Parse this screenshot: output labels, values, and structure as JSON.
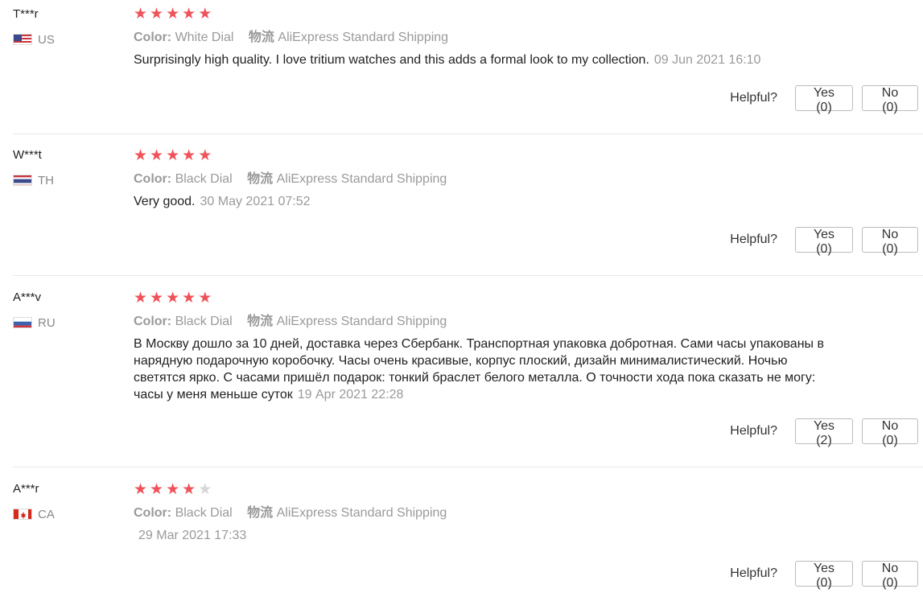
{
  "labels": {
    "color": "Color:",
    "shipping_label": "物流",
    "helpful": "Helpful?"
  },
  "colors": {
    "star_on": "#f0525a",
    "star_off": "#d6d6d6"
  },
  "reviews": [
    {
      "user": "T***r",
      "country": "US",
      "rating": 5,
      "color_value": "White Dial",
      "shipping": "AliExpress Standard Shipping",
      "text": "Surprisingly high quality. I love tritium watches and this adds a formal look to my collection.",
      "date": "09 Jun 2021 16:10",
      "yes": "Yes (0)",
      "no": "No (0)"
    },
    {
      "user": "W***t",
      "country": "TH",
      "rating": 5,
      "color_value": "Black Dial",
      "shipping": "AliExpress Standard Shipping",
      "text": "Very good.",
      "date": "30 May 2021 07:52",
      "yes": "Yes (0)",
      "no": "No (0)"
    },
    {
      "user": "A***v",
      "country": "RU",
      "rating": 5,
      "color_value": "Black Dial",
      "shipping": "AliExpress Standard Shipping",
      "text": "В Москву дошло за 10 дней, доставка через Сбербанк. Транспортная упаковка добротная. Сами часы упакованы в нарядную подарочную коробочку. Часы очень красивые, корпус плоский, дизайн минималистический. Ночью светятся ярко. С часами пришёл подарок: тонкий браслет белого металла. О точности хода пока сказать не могу: часы у меня меньше суток",
      "date": "19 Apr 2021 22:28",
      "yes": "Yes (2)",
      "no": "No (0)"
    },
    {
      "user": "A***r",
      "country": "CA",
      "rating": 4,
      "color_value": "Black Dial",
      "shipping": "AliExpress Standard Shipping",
      "text": "",
      "date": "29 Mar 2021 17:33",
      "yes": "Yes (0)",
      "no": "No (0)"
    }
  ]
}
